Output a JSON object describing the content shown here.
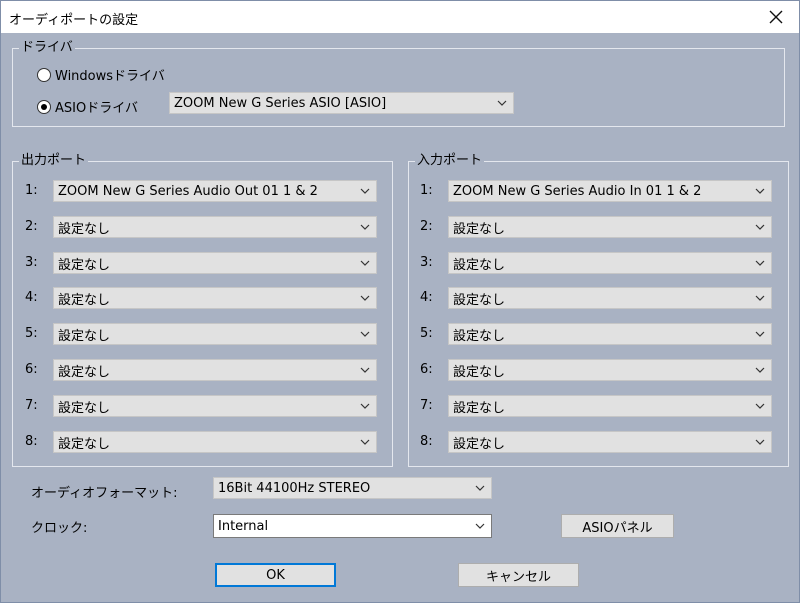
{
  "window": {
    "title": "オーディポートの設定"
  },
  "driver_group": {
    "legend": "ドライバ",
    "options": [
      {
        "label": "Windowsドライバ",
        "selected": false
      },
      {
        "label": "ASIOドライバ",
        "selected": true
      }
    ],
    "asio_device": "ZOOM New G Series ASIO [ASIO]"
  },
  "output_ports": {
    "legend": "出力ポート",
    "rows": [
      {
        "num": "1:",
        "value": "ZOOM New G Series Audio Out 01 1 & 2"
      },
      {
        "num": "2:",
        "value": "設定なし"
      },
      {
        "num": "3:",
        "value": "設定なし"
      },
      {
        "num": "4:",
        "value": "設定なし"
      },
      {
        "num": "5:",
        "value": "設定なし"
      },
      {
        "num": "6:",
        "value": "設定なし"
      },
      {
        "num": "7:",
        "value": "設定なし"
      },
      {
        "num": "8:",
        "value": "設定なし"
      }
    ]
  },
  "input_ports": {
    "legend": "入力ポート",
    "rows": [
      {
        "num": "1:",
        "value": "ZOOM New G Series Audio In 01 1 & 2"
      },
      {
        "num": "2:",
        "value": "設定なし"
      },
      {
        "num": "3:",
        "value": "設定なし"
      },
      {
        "num": "4:",
        "value": "設定なし"
      },
      {
        "num": "5:",
        "value": "設定なし"
      },
      {
        "num": "6:",
        "value": "設定なし"
      },
      {
        "num": "7:",
        "value": "設定なし"
      },
      {
        "num": "8:",
        "value": "設定なし"
      }
    ]
  },
  "audio_format": {
    "label": "オーディオフォーマット:",
    "value": "16Bit  44100Hz STEREO"
  },
  "clock": {
    "label": "クロック:",
    "value": "Internal"
  },
  "buttons": {
    "asio_panel": "ASIOパネル",
    "ok": "OK",
    "cancel": "キャンセル"
  },
  "colors": {
    "dialog_bg": "#a9b2c3",
    "combo_bg": "#e1e1e1",
    "focus_border": "#0078d7"
  }
}
